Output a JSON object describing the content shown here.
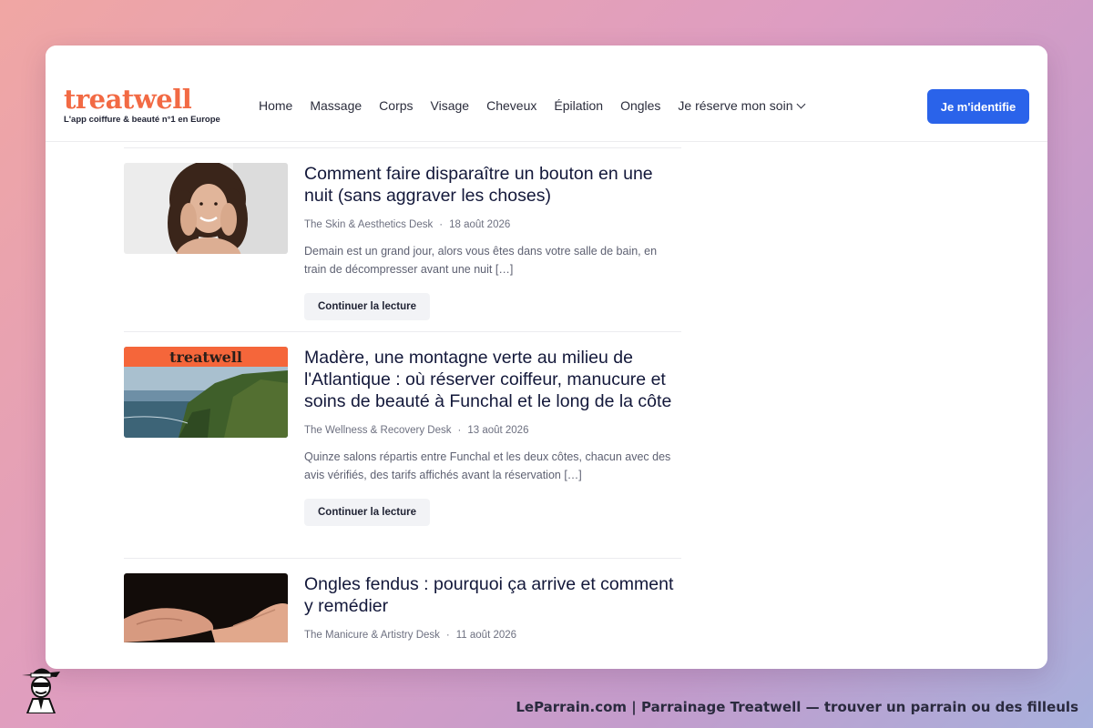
{
  "nav": {
    "logo": "treatwell",
    "tagline": "L'app coiffure & beauté n°1 en Europe",
    "links": [
      "Home",
      "Massage",
      "Corps",
      "Visage",
      "Cheveux",
      "Épilation",
      "Ongles",
      "Je réserve mon soin"
    ],
    "login": "Je m'identifie"
  },
  "articles": [
    {
      "title": "Comment faire disparaître un bouton en une nuit (sans aggraver les choses)",
      "author": "The Skin & Aesthetics Desk",
      "date": "18 août 2026",
      "excerpt": "Demain est un grand jour, alors vous êtes dans votre salle de bain, en train de décompresser avant une nuit […]",
      "cta": "Continuer la lecture"
    },
    {
      "title": "Madère, une montagne verte au milieu de l'Atlantique : où réserver coiffeur, manucure et soins de beauté à Funchal et le long de la côte",
      "author": "The Wellness & Recovery Desk",
      "date": "13 août 2026",
      "excerpt": "Quinze salons répartis entre Funchal et les deux côtes, chacun avec des avis vérifiés, des tarifs affichés avant la réservation […]",
      "cta": "Continuer la lecture",
      "thumb_banner": "treatwell"
    },
    {
      "title": "Ongles fendus : pourquoi ça arrive et comment y remédier",
      "author": "The Manicure & Artistry Desk",
      "date": "11 août 2026"
    }
  ],
  "footer": {
    "caption": "LeParrain.com | Parrainage Treatwell — trouver un parrain ou des filleuls"
  },
  "colors": {
    "brand": "#f26a44",
    "accent": "#2a63ea",
    "title": "#13183a"
  }
}
